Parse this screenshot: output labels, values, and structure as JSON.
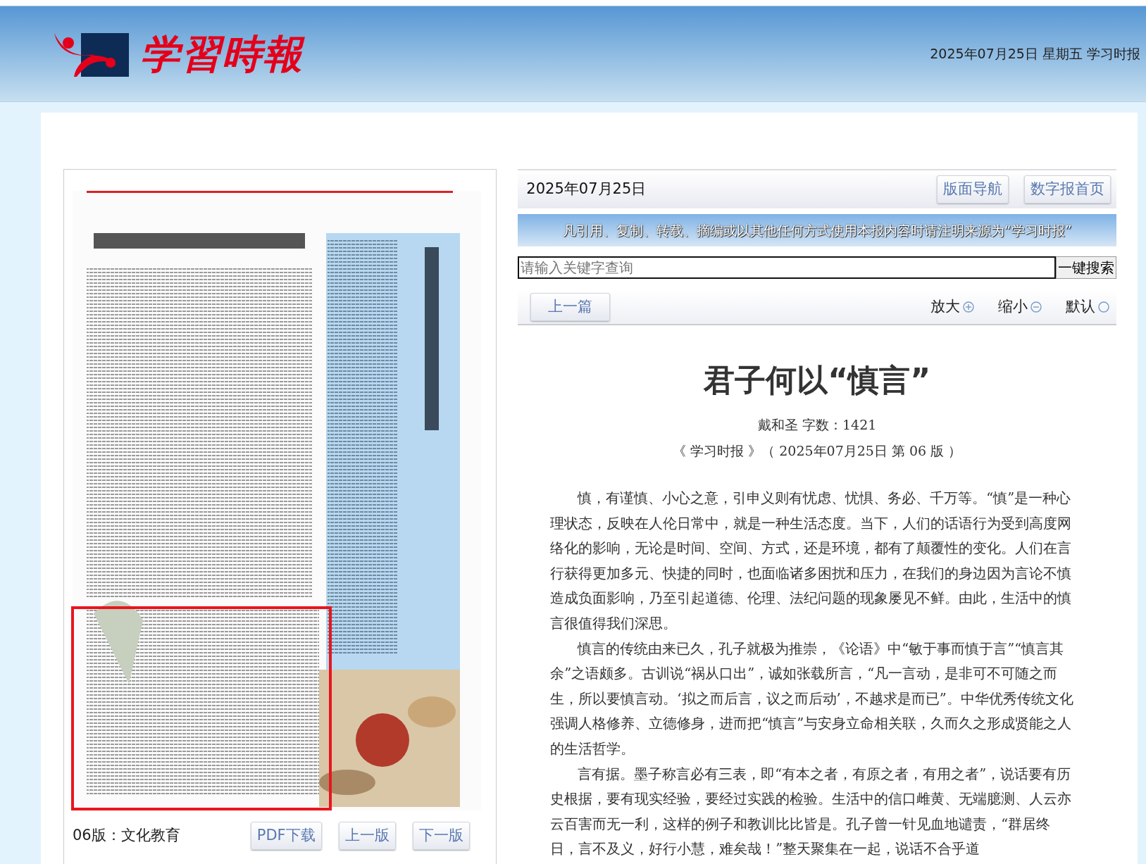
{
  "header": {
    "logo_text": "学習時報",
    "date_line": "2025年07月25日 星期五 学习时报"
  },
  "page_view": {
    "highlight": true,
    "edition_label": "06版：文化教育",
    "buttons": [
      "PDF下载",
      "上一版",
      "下一版"
    ]
  },
  "article_panel": {
    "date": "2025年07月25日",
    "nav_buttons": [
      "版面导航",
      "数字报首页"
    ],
    "notice": "凡引用、复制、转载、摘编或以其他任何方式使用本报内容时请注明来源为“学习时报”",
    "search": {
      "placeholder": "请输入关键字查询",
      "button": "一键搜索"
    },
    "prev_button": "上一篇",
    "font_controls": [
      {
        "label": "放大",
        "kind": "plus"
      },
      {
        "label": "缩小",
        "kind": "minus"
      },
      {
        "label": "默认",
        "kind": "reset"
      }
    ],
    "title": "君子何以“慎言”",
    "byline": "戴和圣 字数：1421",
    "source": "《 学习时报 》（ 2025年07月25日 第 06 版 ）",
    "paragraphs": [
      "慎，有谨慎、小心之意，引申义则有忧虑、忧惧、务必、千万等。“慎”是一种心理状态，反映在人伦日常中，就是一种生活态度。当下，人们的话语行为受到高度网络化的影响，无论是时间、空间、方式，还是环境，都有了颠覆性的变化。人们在言行获得更加多元、快捷的同时，也面临诸多困扰和压力，在我们的身边因为言论不慎造成负面影响，乃至引起道德、伦理、法纪问题的现象屡见不鲜。由此，生活中的慎言很值得我们深思。",
      "慎言的传统由来已久，孔子就极为推崇，《论语》中“敏于事而慎于言”“慎言其余”之语颇多。古训说“祸从口出”，诚如张载所言，“凡一言动，是非可不可随之而生，所以要慎言动。‘拟之而后言，议之而后动’，不越求是而已”。中华优秀传统文化强调人格修养、立德修身，进而把“慎言”与安身立命相关联，久而久之形成贤能之人的生活哲学。",
      "言有据。墨子称言必有三表，即“有本之者，有原之者，有用之者”，说话要有历史根据，要有现实经验，要经过实践的检验。生活中的信口雌黄、无端臆测、人云亦云百害而无一利，这样的例子和教训比比皆是。孔子曾一针见血地谴责，“群居终日，言不及义，好行小慧，难矣哉！”整天聚集在一起，说话不合乎道"
    ]
  }
}
